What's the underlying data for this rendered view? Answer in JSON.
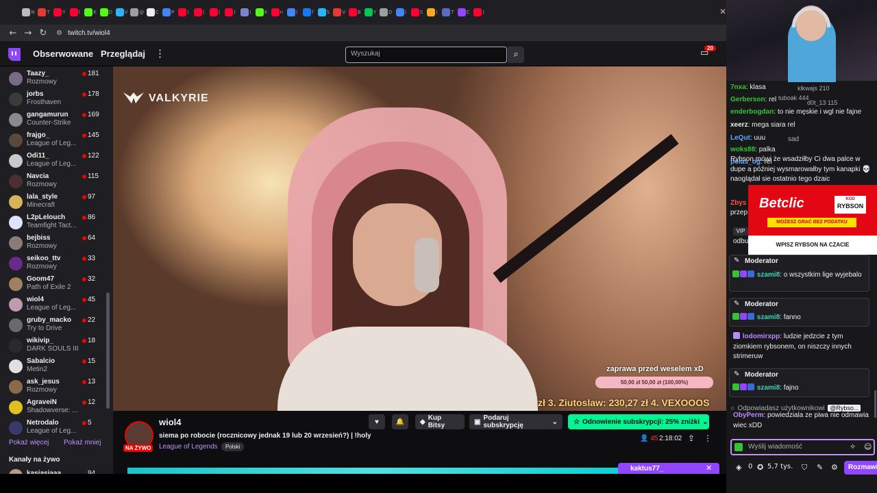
{
  "browser": {
    "url": "twitch.tv/wiol4",
    "tab_glyphs": [
      "N",
      "T",
      "Y",
      "(",
      "K",
      "D",
      "V",
      "@",
      "C",
      "P",
      "(",
      "(",
      "(",
      "(",
      "(",
      "K",
      "n",
      "(",
      "f",
      "S",
      "V",
      "B",
      "Y",
      "D",
      "(",
      "S",
      "(",
      "T",
      "C",
      "("
    ],
    "tab_colors": [
      "#bbbbbb",
      "#e53935",
      "#ff0033",
      "#ff0033",
      "#53fc18",
      "#53fc18",
      "#29b6f6",
      "#9e9e9e",
      "#eeeeee",
      "#4285f4",
      "#ff0033",
      "#ff0033",
      "#ff0033",
      "#ff0033",
      "#7986cb",
      "#53fc18",
      "#ff0033",
      "#4285f4",
      "#1877f2",
      "#29b6f6",
      "#e53935",
      "#ff0033",
      "#00c853",
      "#9e9e9e",
      "#4285f4",
      "#ff0033",
      "#f9a825",
      "#5c6bc0",
      "#9147ff",
      "#ff0033"
    ]
  },
  "topnav": {
    "following": "Obserwowane",
    "browse": "Przeglądaj",
    "search_placeholder": "Wyszukaj",
    "notif_count": "20"
  },
  "sidebar": {
    "channels": [
      {
        "name": "Taazy_",
        "game": "Rozmowy",
        "viewers": "181",
        "color": "#7a6a8a"
      },
      {
        "name": "jorbs",
        "game": "Frosthaven",
        "viewers": "178",
        "color": "#3b3b3b"
      },
      {
        "name": "gangamurun",
        "game": "Counter-Strike",
        "viewers": "169",
        "color": "#8a8a8a"
      },
      {
        "name": "frajgo_",
        "game": "League of Leg...",
        "viewers": "145",
        "color": "#5a4a3a"
      },
      {
        "name": "Odi11_",
        "game": "League of Leg...",
        "viewers": "122",
        "color": "#c9c9c9"
      },
      {
        "name": "Navcia",
        "game": "Rozmowy",
        "viewers": "115",
        "color": "#4a3030"
      },
      {
        "name": "lala_style",
        "game": "Minecraft",
        "viewers": "97",
        "color": "#d8b35a"
      },
      {
        "name": "L2pLelouch",
        "game": "Teamfight Tact...",
        "viewers": "86",
        "color": "#e0e0ff"
      },
      {
        "name": "bejbiss",
        "game": "Rozmowy",
        "viewers": "64",
        "color": "#8a7a7a"
      },
      {
        "name": "seikoo_ttv",
        "game": "Rozmowy",
        "viewers": "33",
        "color": "#6a2a8a"
      },
      {
        "name": "Goom47",
        "game": "Path of Exile 2",
        "viewers": "32",
        "color": "#a08060"
      },
      {
        "name": "wiol4",
        "game": "League of Leg...",
        "viewers": "45",
        "color": "#c09ab0"
      },
      {
        "name": "gruby_macko",
        "game": "Try to Drive",
        "viewers": "22",
        "color": "#6a6a6a"
      },
      {
        "name": "wikivip_",
        "game": "DARK SOULS III",
        "viewers": "18",
        "color": "#2a2a2a"
      },
      {
        "name": "Sabalcio",
        "game": "Metin2",
        "viewers": "15",
        "color": "#e0e0e0"
      },
      {
        "name": "ask_jesus",
        "game": "Rozmowy",
        "viewers": "13",
        "color": "#8a6a4a"
      },
      {
        "name": "AgraveiN",
        "game": "Shadowverse: ...",
        "viewers": "12",
        "color": "#e0c020"
      },
      {
        "name": "Netrodalo",
        "game": "League of Leg...",
        "viewers": "5",
        "color": "#3a3a6a"
      }
    ],
    "show_more": "Pokaż więcej",
    "show_less": "Pokaż mniej",
    "live_channels": "Kanały na żywo",
    "live_first_name": "kasiasiaaa",
    "live_first_viewers": "94"
  },
  "video": {
    "brand": "VALKYRIE",
    "overlay_text": "zaprawa przed weselem xD",
    "goal": "50,00 zł   50,00 zł (100,00%)",
    "ticker": "zł   3. Ziutoslaw: 230,27 zł   4. VEXOOOS"
  },
  "stream": {
    "live": "NA ŻYWO",
    "streamer": "wiol4",
    "title": "siema po robocie (rocznicowy jednak 19 lub 20 wrzesień?) | !holy",
    "game": "League of Legends",
    "language": "Polski",
    "buy_bits": "Kup Bitsy",
    "gift_sub": "Podaruj subskrypcję",
    "renew": "Odnowienie subskrypcji: 25% zniżki",
    "viewers": "45",
    "uptime": "2:18:02",
    "popup_user": "kaktus77_"
  },
  "chat": {
    "top_users": [
      "klkwajs 210",
      "tuboak 444",
      "d0t_13 115"
    ],
    "messages": [
      {
        "user": "7nxa",
        "text": ": klasa",
        "color": "u-green"
      },
      {
        "user": "Gerberson",
        "text": ": rel",
        "color": "u-green"
      },
      {
        "user": "enderbogdan",
        "text": ": to nie męskie i wgl nie fajne",
        "color": "u-green"
      },
      {
        "user": "xeerz",
        "text": ": mega siara rel",
        "color": "u-white"
      },
      {
        "user": "LeQut",
        "text": ": uuu",
        "color": "u-blue"
      },
      {
        "user": "woks88",
        "text": ": palka",
        "color": "u-green"
      },
      {
        "user": "polas_og",
        "text": ": rel",
        "color": "u-blue"
      }
    ],
    "sad": "sad",
    "long_msg": "Rybson mówi że wsadziłby Ci dwa palce w dupe a później wysmarowałby tym kanapki 💀 naoglądał sie ostatnio tego dzaic",
    "zbys": "Zbys",
    "przep": "przep",
    "vip": "VIP",
    "odbu": "odbu",
    "moderator": "Moderator",
    "mod1_user": "szami8",
    "mod1_text": ": o wszystkim lige wyjebalo",
    "mod2_user": "szami8",
    "mod2_text": ": fanno",
    "lodo_user": "lodomirxpp",
    "lodo_text": ": ludzie jedzcie z tym ziomkiem rybsonem, on niszczy innych strimeruw",
    "mod3_user": "szami8",
    "mod3_text": ": fajno",
    "reply_label": "Odpowiadasz użytkownikowi",
    "reply_mention": "@Rybso...",
    "oby_user": "ObyPerm",
    "oby_text": ": powiedziala ze piwa nie odmawia wiec xDD",
    "input_placeholder": "Wyślij wiadomość",
    "points": "0",
    "points2": "5,7 tys.",
    "chat_button": "Rozmawiaj",
    "betclic": {
      "logo": "Betclic",
      "kod": "KOD",
      "code": "RYBSON",
      "strip": "MOŻESZ GRAĆ BEZ PODATKU",
      "bottom": "WPISZ RYBSON NA CZACIE"
    }
  }
}
